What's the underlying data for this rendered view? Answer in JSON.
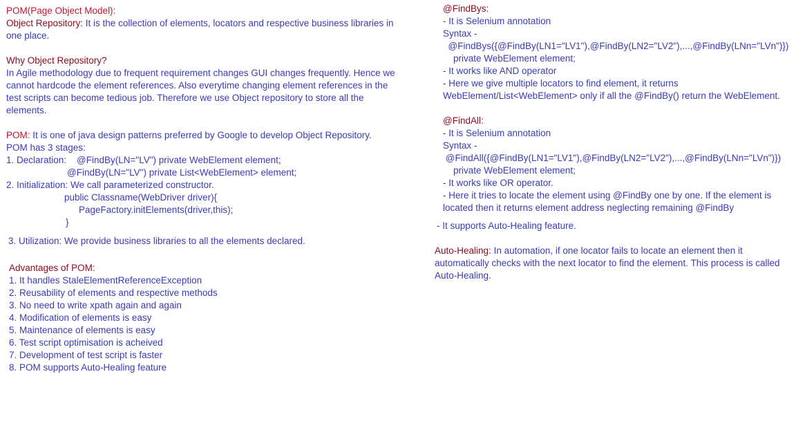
{
  "colors": {
    "heading_red": "#c0152f",
    "heading_darkred": "#8b0a1e",
    "body_blue": "#3b3bb3"
  },
  "left": {
    "pom_title": "POM(Page Object Model):",
    "obj_repo_label": "Object Repository:",
    "obj_repo_text_1": " It is the collection of elements, locators and respective business libraries in",
    "obj_repo_text_2": "one place.",
    "why_heading": "Why Object Repository?",
    "why_lines": [
      "In Agile methodology due to frequent requirement changes GUI changes frequently. Hence we",
      "cannot hardcode the element references. Also everytime changing element references in the",
      "test scripts can become tedious job. Therefore we use Object repository to store all the",
      "elements."
    ],
    "pom_label": "POM:",
    "pom_text": " It is one of java design patterns preferred by Google to develop Object Repository.",
    "stages_intro": "POM has 3 stages:",
    "declaration_1": "1. Declaration:    @FindBy(LN=\"LV\") private WebElement element;",
    "declaration_2": "@FindBy(LN=\"LV\") private List<WebElement> element;",
    "initialization": "2. Initialization: We call parameterized constructor.",
    "constructor_1": "public Classname(WebDriver driver){",
    "constructor_2": "PageFactory.initElements(driver,this);",
    "constructor_3": "}",
    "utilization": "3. Utilization: We provide business libraries to all the elements declared.",
    "advantages_heading": "Advantages of POM:",
    "advantages": [
      "1. It handles StaleElementReferenceException",
      "2. Reusability of elements and respective methods",
      "3. No need to write xpath again and again",
      "4. Modification of elements is easy",
      "5. Maintenance of elements is easy",
      "6. Test script optimisation is acheived",
      "7. Development of test script is faster",
      "8. POM supports Auto-Healing feature"
    ]
  },
  "right": {
    "findbys_heading": "@FindBys:",
    "findbys_lines": [
      "- It is Selenium annotation",
      "Syntax -",
      "  @FindBys({@FindBy(LN1=\"LV1\"),@FindBy(LN2=\"LV2\"),...,@FindBy(LNn=\"LVn\")})",
      "    private WebElement element;",
      "- It works like AND operator",
      "- Here we give multiple locators to find element, it returns",
      "WebElement/List<WebElement> only if all the @FindBy() return the WebElement."
    ],
    "findall_heading": "@FindAll:",
    "findall_lines": [
      "- It is Selenium annotation",
      "Syntax -",
      " @FindAll({@FindBy(LN1=\"LV1\"),@FindBy(LN2=\"LV2\"),...,@FindBy(LNn=\"LVn\")})",
      "    private WebElement element;",
      "- It works like OR operator.",
      "- Here it tries to locate the element using @FindBy one by one. If the element is",
      "located then it returns element address neglecting remaining @FindBy"
    ],
    "autoheal_support": "- It supports Auto-Healing feature.",
    "autoheal_label": "Auto-Healing:",
    "autoheal_text_1": " In automation, if one locator fails to locate an element then it",
    "autoheal_text_2": "automatically checks with the next locator to find the element. This process is called",
    "autoheal_text_3": "Auto-Healing."
  }
}
